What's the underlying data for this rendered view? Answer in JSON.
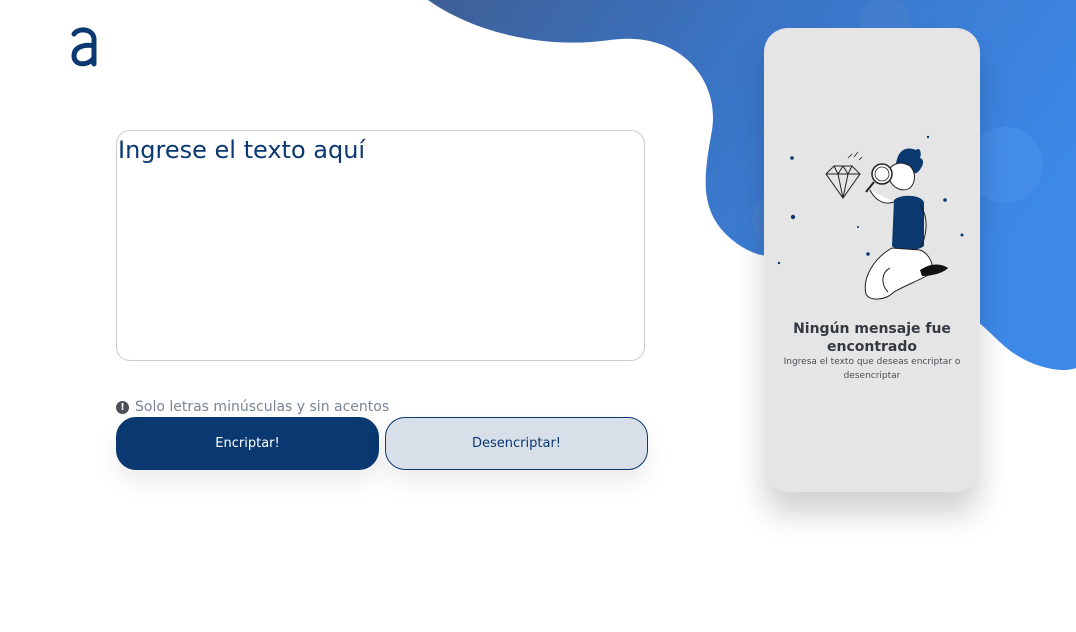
{
  "header": {
    "logo_icon": "alura-a-logo-icon"
  },
  "editor": {
    "placeholder": "Ingrese el texto aquí",
    "value": ""
  },
  "hint": {
    "icon": "exclamation-circle-icon",
    "text": "Solo letras minúsculas y sin acentos"
  },
  "buttons": {
    "encrypt_label": "Encriptar!",
    "decrypt_label": "Desencriptar!"
  },
  "output_panel": {
    "illustration": "person-searching-diamond-illustration",
    "title": "Ningún mensaje fue encontrado",
    "subtitle": "Ingresa el texto que deseas encriptar o desencriptar"
  },
  "colors": {
    "primary": "#0a3871",
    "secondary_button": "#d8dfe8",
    "panel_bg": "#e5e5e5",
    "blob_light": "#3b8bea",
    "blob_dark": "#3a6cb0"
  }
}
